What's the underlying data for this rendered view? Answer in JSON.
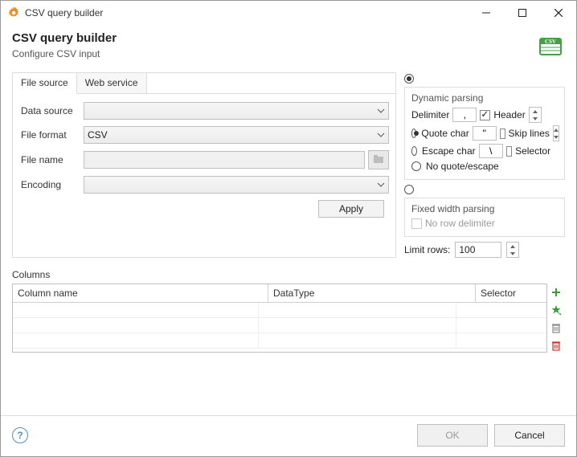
{
  "window": {
    "title": "CSV query builder"
  },
  "header": {
    "title": "CSV query builder",
    "subtitle": "Configure CSV input"
  },
  "tabs": [
    "File source",
    "Web service"
  ],
  "form": {
    "datasource": {
      "label": "Data source",
      "value": ""
    },
    "fileformat": {
      "label": "File format",
      "value": "CSV"
    },
    "filename": {
      "label": "File name",
      "value": ""
    },
    "encoding": {
      "label": "Encoding",
      "value": ""
    },
    "apply": "Apply"
  },
  "parsing": {
    "dynamic": {
      "title": "Dynamic parsing",
      "delimiter": {
        "label": "Delimiter",
        "value": ","
      },
      "header": "Header",
      "quote": {
        "label": "Quote char",
        "value": "\""
      },
      "skip": "Skip lines",
      "escape": {
        "label": "Escape char",
        "value": "\\"
      },
      "selector": "Selector",
      "noquote": "No quote/escape"
    },
    "fixed": {
      "title": "Fixed width parsing",
      "norow": "No row delimiter"
    },
    "limit": {
      "label": "Limit rows:",
      "value": "100"
    }
  },
  "columns": {
    "label": "Columns",
    "headers": [
      "Column name",
      "DataType",
      "Selector"
    ],
    "rows": []
  },
  "footer": {
    "ok": "OK",
    "cancel": "Cancel"
  }
}
